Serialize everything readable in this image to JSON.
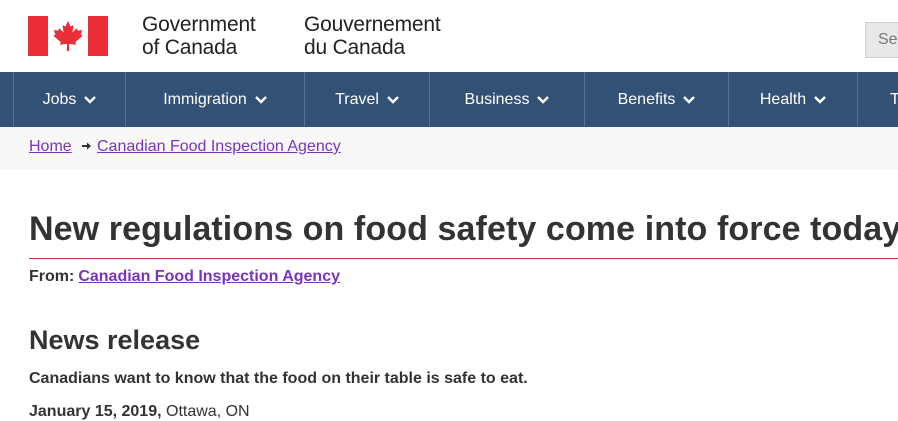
{
  "header": {
    "signature_en": [
      "Government",
      "of Canada"
    ],
    "signature_fr": [
      "Gouvernement",
      "du Canada"
    ],
    "search_placeholder": "Se",
    "flag_color": "#eb2d37"
  },
  "menu": {
    "items": [
      {
        "label": "Jobs"
      },
      {
        "label": "Immigration"
      },
      {
        "label": "Travel"
      },
      {
        "label": "Business"
      },
      {
        "label": "Benefits"
      },
      {
        "label": "Health"
      },
      {
        "label": "T"
      }
    ],
    "background": "#335075"
  },
  "breadcrumb": {
    "items": [
      "Home",
      "Canadian Food Inspection Agency"
    ]
  },
  "article": {
    "title": "New regulations on food safety come into force today",
    "from_label": "From:",
    "from_link": "Canadian Food Inspection Agency",
    "section_heading": "News release",
    "lead": "Canadians want to know that the food on their table is safe to eat.",
    "date": "January 15, 2019,",
    "location": "Ottawa, ON"
  },
  "colors": {
    "link": "#7834bc",
    "title_rule": "#af3c43",
    "text": "#333333"
  }
}
